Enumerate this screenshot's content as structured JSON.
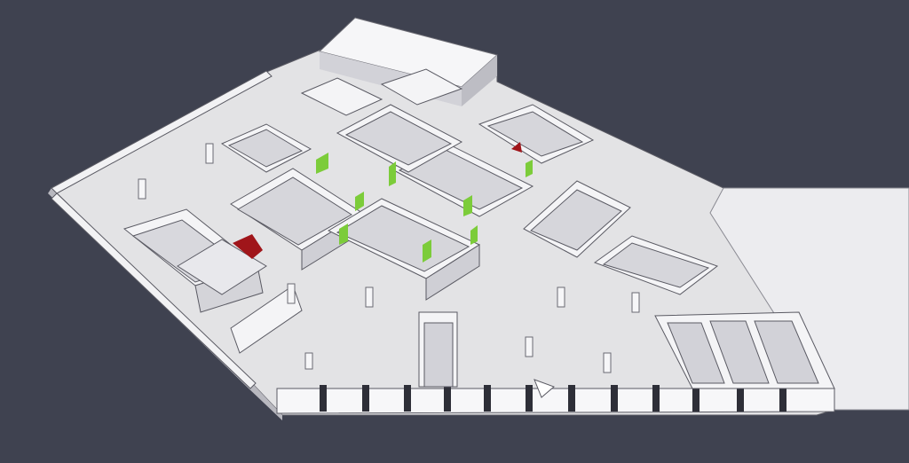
{
  "colors": {
    "background": "#3f4250",
    "floor": "#e3e3e5",
    "floor_shadow": "#cfcfd3",
    "wall_top": "#f4f4f6",
    "wall_side": "#d4d4d9",
    "wall_dark": "#9a9aa2",
    "outline": "#5a5a63",
    "door_green": "#7ccc3a",
    "door_red": "#a0151a"
  },
  "scene": {
    "kind": "3d-office-floorplan",
    "door_markers": [
      {
        "id": "green-1",
        "color_key": "door_green"
      },
      {
        "id": "green-2",
        "color_key": "door_green"
      },
      {
        "id": "green-3",
        "color_key": "door_green"
      },
      {
        "id": "green-4",
        "color_key": "door_green"
      },
      {
        "id": "green-5",
        "color_key": "door_green"
      },
      {
        "id": "green-6",
        "color_key": "door_green"
      },
      {
        "id": "green-7",
        "color_key": "door_green"
      },
      {
        "id": "green-8",
        "color_key": "door_green"
      },
      {
        "id": "red-1",
        "color_key": "door_red"
      },
      {
        "id": "red-2",
        "color_key": "door_red"
      }
    ]
  }
}
